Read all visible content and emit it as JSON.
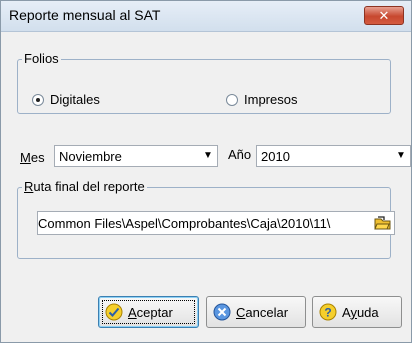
{
  "window": {
    "title": "Reporte mensual al SAT",
    "close_glyph": "✕"
  },
  "folios": {
    "legend": "Folios",
    "options": [
      {
        "label": "Digitales",
        "checked": true
      },
      {
        "label": "Impresos",
        "checked": false
      }
    ]
  },
  "period": {
    "month_label_mnemonic": "M",
    "month_label_rest": "es",
    "month_value": "Noviembre",
    "year_label": "Año",
    "year_value": "2010"
  },
  "route": {
    "legend_mnemonic": "R",
    "legend_rest": "uta final del reporte",
    "path": "Common Files\\Aspel\\Comprobantes\\Caja\\2010\\11\\",
    "browse_icon": "folder-icon"
  },
  "buttons": {
    "accept_mnemonic": "A",
    "accept_rest": "ceptar",
    "cancel_mnemonic": "C",
    "cancel_rest": "ancelar",
    "help_prefix": "A",
    "help_mnemonic": "y",
    "help_rest": "uda"
  },
  "colors": {
    "accept_icon": "#f2c200",
    "cancel_icon": "#3c7fd6",
    "help_icon": "#f2c200",
    "close_button": "#c7482f"
  }
}
